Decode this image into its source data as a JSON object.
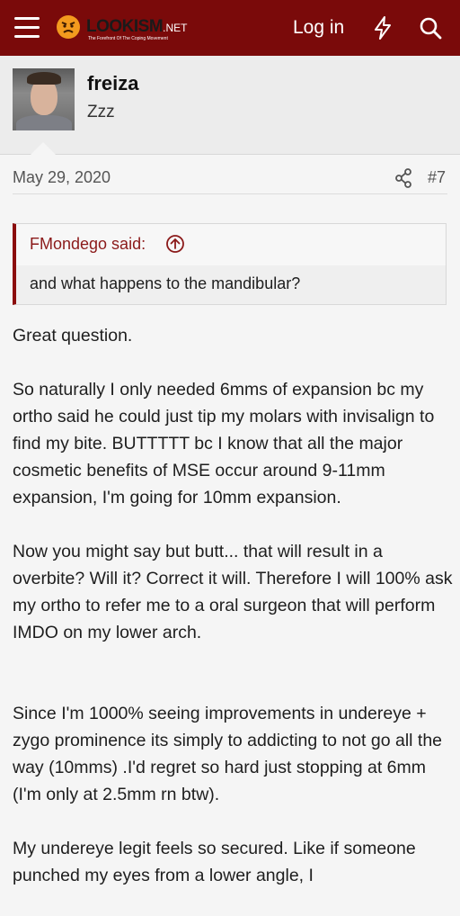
{
  "header": {
    "logo_text": "LOOKISM",
    "logo_net": ".NET",
    "logo_tagline": "The Forefront Of The Coping Movement",
    "login_label": "Log in",
    "icons": [
      "hamburger-menu-icon",
      "angry-face-logo-icon",
      "lightning-bolt-icon",
      "search-icon"
    ],
    "background_color": "#7a0a0a"
  },
  "user": {
    "name": "freiza",
    "title": "Zzz"
  },
  "post_meta": {
    "date": "May 29, 2020",
    "number": "#7",
    "share_icon": "share-icon"
  },
  "quote": {
    "author": "FMondego said:",
    "text": "and what happens to the mandibular?",
    "accent_color": "#8b0d0d"
  },
  "post": {
    "paragraphs": [
      "Great question.",
      "So naturally I only needed 6mms of expansion bc my ortho said he could just tip my molars with invisalign to find my bite. BUTTTTT bc I know that all the major cosmetic benefits of MSE occur around 9-11mm expansion, I'm going for 10mm expansion.",
      "Now you might say but butt... that will result in a overbite? Will it? Correct it will. Therefore I will 100% ask my ortho to refer me to a oral surgeon that will perform IMDO on my lower arch.",
      "Since I'm 1000% seeing improvements in undereye + zygo prominence its simply to addicting to not go all the way (10mms) .I'd regret so hard just stopping at 6mm (I'm only at 2.5mm rn btw).",
      "My undereye legit feels so secured. Like if someone punched my eyes from a lower angle, I"
    ]
  }
}
